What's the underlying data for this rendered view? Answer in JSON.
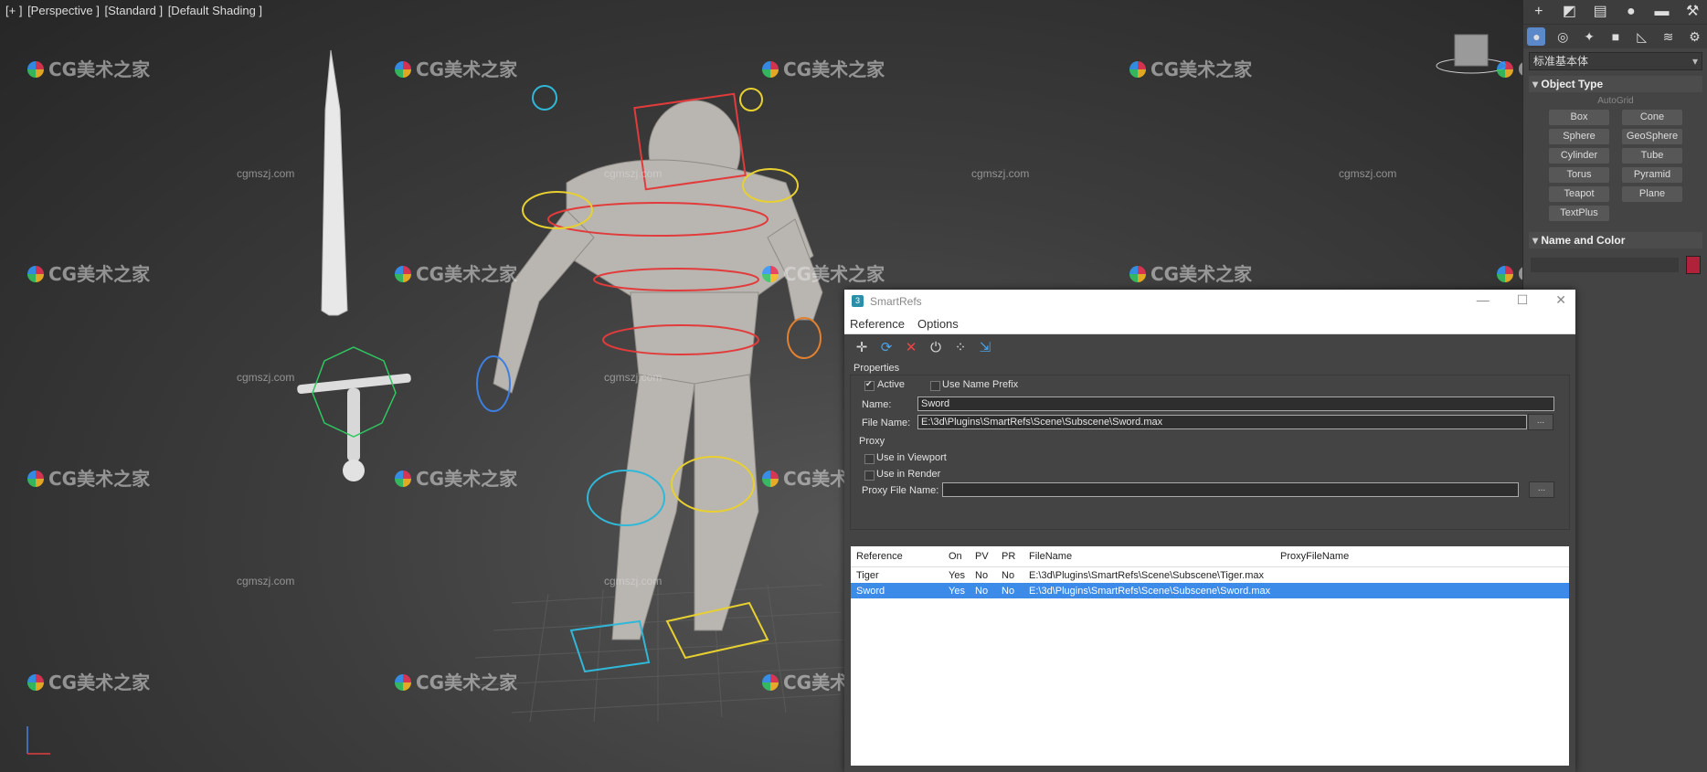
{
  "viewport": {
    "labels": [
      "[+ ]",
      "[Perspective ]",
      "[Standard ]",
      "[Default Shading ]"
    ]
  },
  "watermarks": {
    "logo_text": "CG美术之家",
    "site_text": "cgmszj.com"
  },
  "command_panel": {
    "dropdown_value": "标准基本体",
    "object_type": {
      "title": "Object Type",
      "autogrid": "AutoGrid",
      "buttons": [
        "Box",
        "Cone",
        "Sphere",
        "GeoSphere",
        "Cylinder",
        "Tube",
        "Torus",
        "Pyramid",
        "Teapot",
        "Plane",
        "TextPlus"
      ]
    },
    "name_and_color": {
      "title": "Name and Color",
      "color": "#b0223a"
    },
    "top_icons": [
      "create-icon",
      "modify-icon",
      "hierarchy-icon",
      "motion-icon",
      "display-icon",
      "utilities-icon"
    ],
    "category_icons": [
      "geometry-icon",
      "shapes-icon",
      "lights-icon",
      "cameras-icon",
      "helpers-icon",
      "spacewarps-icon",
      "systems-icon"
    ]
  },
  "dialog": {
    "title": "SmartRefs",
    "menu": [
      "Reference",
      "Options"
    ],
    "toolbar_icons": [
      "add-reference-icon",
      "refresh-icon",
      "delete-icon",
      "power-icon",
      "select-nodes-icon",
      "merge-icon"
    ],
    "properties": {
      "title": "Properties",
      "active_label": "Active",
      "active_checked": true,
      "use_name_prefix_label": "Use Name Prefix",
      "use_name_prefix_checked": false,
      "name_label": "Name:",
      "name_value": "Sword",
      "file_name_label": "File Name:",
      "file_name_value": "E:\\3d\\Plugins\\SmartRefs\\Scene\\Subscene\\Sword.max",
      "browse_label": "...",
      "proxy_title": "Proxy",
      "use_in_viewport_label": "Use in Viewport",
      "use_in_render_label": "Use in Render",
      "proxy_file_name_label": "Proxy File Name:",
      "proxy_file_name_value": ""
    },
    "table": {
      "columns": [
        "Reference",
        "On",
        "PV",
        "PR",
        "FileName",
        "ProxyFileName"
      ],
      "rows": [
        {
          "reference": "Tiger",
          "on": "Yes",
          "pv": "No",
          "pr": "No",
          "filename": "E:\\3d\\Plugins\\SmartRefs\\Scene\\Subscene\\Tiger.max",
          "proxy": "",
          "selected": false
        },
        {
          "reference": "Sword",
          "on": "Yes",
          "pv": "No",
          "pr": "No",
          "filename": "E:\\3d\\Plugins\\SmartRefs\\Scene\\Subscene\\Sword.max",
          "proxy": "",
          "selected": true
        }
      ]
    }
  }
}
